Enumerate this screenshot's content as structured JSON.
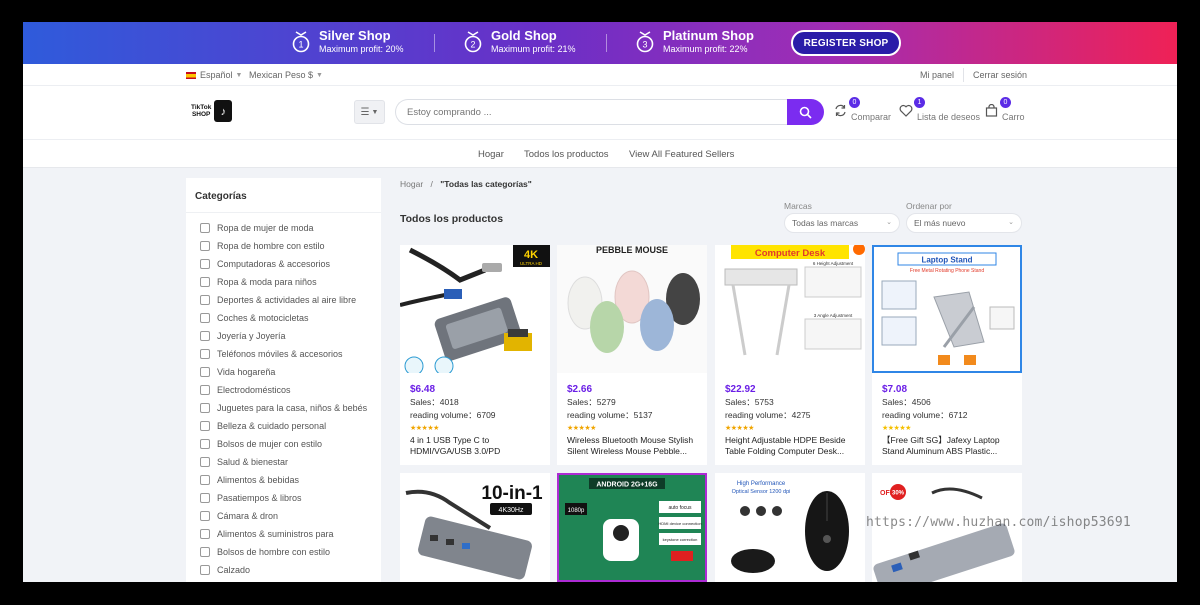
{
  "banner": {
    "tiers": [
      {
        "name": "Silver Shop",
        "sub": "Maximum profit: 20%",
        "level": "1"
      },
      {
        "name": "Gold Shop",
        "sub": "Maximum profit: 21%",
        "level": "2"
      },
      {
        "name": "Platinum Shop",
        "sub": "Maximum profit: 22%",
        "level": "3"
      }
    ],
    "register_label": "REGISTER SHOP"
  },
  "topbar": {
    "language": "Español",
    "currency": "Mexican Peso $",
    "my_panel": "Mi panel",
    "logout": "Cerrar sesión"
  },
  "header": {
    "logo_line1": "TikTok",
    "logo_line2": "SHOP",
    "search_placeholder": "Estoy comprando ...",
    "compare": {
      "label": "Comparar",
      "count": "0"
    },
    "wishlist": {
      "label": "Lista de deseos",
      "count": "1"
    },
    "cart": {
      "label": "Carro",
      "count": "0"
    }
  },
  "nav": {
    "items": [
      "Hogar",
      "Todos los productos",
      "View All Featured Sellers"
    ]
  },
  "sidebar": {
    "title": "Categorías",
    "items": [
      "Ropa de mujer de moda",
      "Ropa de hombre con estilo",
      "Computadoras & accesorios",
      "Ropa & moda para niños",
      "Deportes & actividades al aire libre",
      "Coches & motocicletas",
      "Joyería y Joyería",
      "Teléfonos móviles & accesorios",
      "Vida hogareña",
      "Electrodomésticos",
      "Juguetes para la casa, niños & bebés",
      "Belleza & cuidado personal",
      "Bolsos de mujer con estilo",
      "Salud & bienestar",
      "Alimentos & bebidas",
      "Pasatiempos & libros",
      "Cámara & dron",
      "Alimentos & suministros para",
      "Bolsos de hombre con estilo",
      "Calzado"
    ]
  },
  "breadcrumb": {
    "home": "Hogar",
    "sep": "/",
    "current": "\"Todas las categorías\""
  },
  "main": {
    "title": "Todos los productos",
    "brands_label": "Marcas",
    "brands_value": "Todas las marcas",
    "sort_label": "Ordenar por",
    "sort_value": "El más nuevo"
  },
  "products": [
    {
      "price": "$6.48",
      "sales": "Sales：4018",
      "reading": "reading volume：6709",
      "stars": "★★★★★",
      "title": "4 in 1 USB Type C to HDMI/VGA/USB 3.0/PD Charging...",
      "badge": "4K",
      "badge_sub": "ULTRA HD"
    },
    {
      "price": "$2.66",
      "sales": "Sales：5279",
      "reading": "reading volume：5137",
      "stars": "★★★★★",
      "title": "Wireless Bluetooth Mouse Stylish Silent Wireless Mouse Pebble...",
      "img_title": "PEBBLE MOUSE"
    },
    {
      "price": "$22.92",
      "sales": "Sales：5753",
      "reading": "reading volume：4275",
      "stars": "★★★★★",
      "title": "Height Adjustable HDPE Beside Table Folding Computer Desk...",
      "img_title": "Computer Desk",
      "img_note1": "6 Height Adjustment",
      "img_note2": "3 Angle Adjustment"
    },
    {
      "price": "$7.08",
      "sales": "Sales：4506",
      "reading": "reading volume：6712",
      "stars": "★★★★★",
      "title": "【Free Gift SG】Jafexy Laptop Stand Aluminum ABS Plastic...",
      "img_title": "Laptop Stand",
      "img_sub": "Free Metal Rotating Phone Stand"
    },
    {
      "img_title": "10-in-1",
      "img_badge": "4K30Hz"
    },
    {
      "img_title": "ANDROID 2G+16G",
      "img_badge": "1080p",
      "img_note1": "auto focus",
      "img_note2": "HDMI device connection",
      "img_note3": "keystone correction"
    },
    {
      "img_title": "High Performance",
      "img_sub": "Optical Sensor 1200 dpi"
    },
    {
      "img_badge": "30%",
      "img_title": "OFF"
    }
  ],
  "watermark": "https://www.huzhan.com/ishop53691",
  "colors": {
    "accent": "#7b2cf0",
    "price": "#6a1ee6",
    "badge": "#5b2ce6"
  }
}
